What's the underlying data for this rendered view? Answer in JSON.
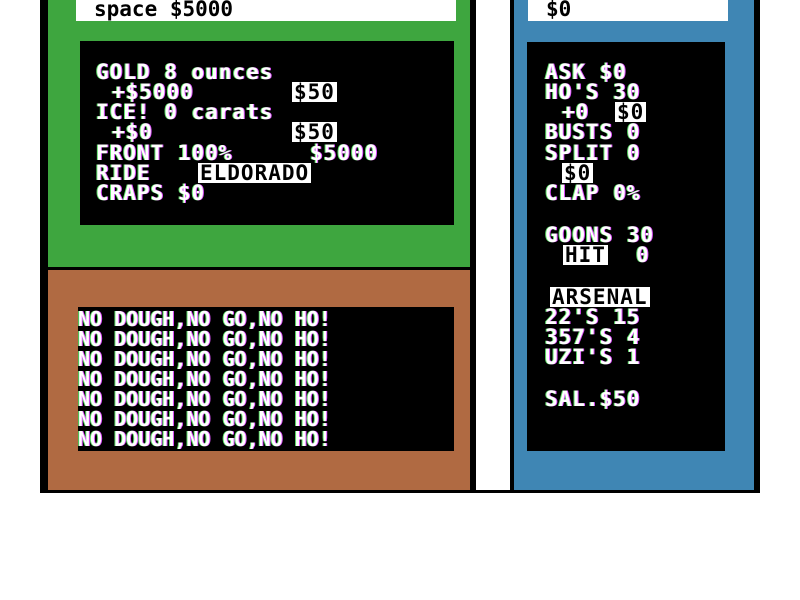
{
  "top_bar": {
    "left_text": "space $5000",
    "right_text": "$0"
  },
  "stats": {
    "gold_line": "GOLD 8 ounces",
    "gold_value": "+$5000",
    "gold_price": "$50",
    "ice_line": "ICE! 0 carats",
    "ice_value": "+$0",
    "ice_price": "$50",
    "front_label": "FRONT 100%",
    "front_value": "$5000",
    "ride_label": "RIDE",
    "ride_value": "ELDORADO",
    "craps_line": "CRAPS $0"
  },
  "motto": {
    "lines": [
      "NO DOUGH,NO GO,NO HO!",
      "NO DOUGH,NO GO,NO HO!",
      "NO DOUGH,NO GO,NO HO!",
      "NO DOUGH,NO GO,NO HO!",
      "NO DOUGH,NO GO,NO HO!",
      "NO DOUGH,NO GO,NO HO!",
      "NO DOUGH,NO GO,NO HO!"
    ]
  },
  "side": {
    "ask_line": "ASK $0",
    "hos_line": "HO'S 30",
    "hos_plus": "+0",
    "hos_plus_value": "$0",
    "busts_line": "BUSTS 0",
    "split_line": "SPLIT 0",
    "split_value": "$0",
    "clap_line": "CLAP 0%",
    "goons_line": "GOONS 30",
    "goons_tag": "HIT",
    "goons_count": "0",
    "arsenal_header": "ARSENAL",
    "weapon_22": "22'S 15",
    "weapon_357": "357'S 4",
    "weapon_uzi": "UZI'S 1",
    "salary": "SAL.$50"
  },
  "colors": {
    "green_panel": "#3ea63f",
    "brown_panel": "#b06a42",
    "blue_panel": "#3f86b4",
    "text": "#ffffff",
    "fringe_magenta": "#e052ff",
    "fringe_green": "#5fe06a"
  }
}
